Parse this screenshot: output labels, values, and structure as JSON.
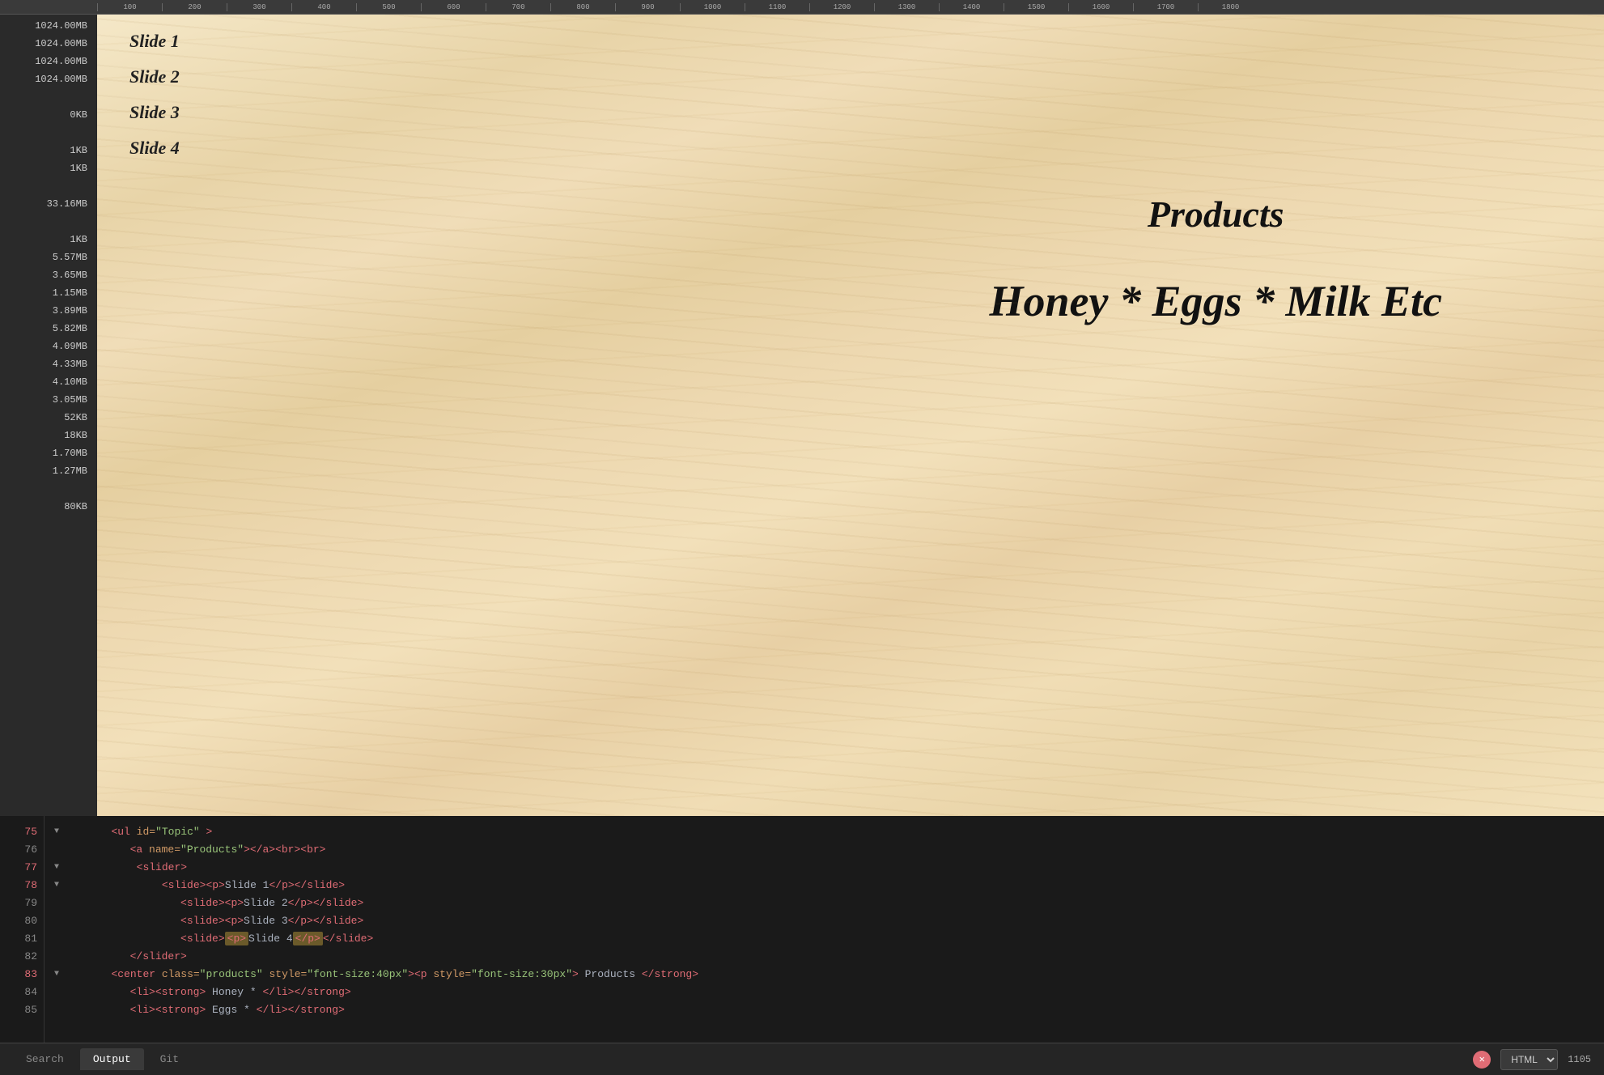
{
  "ruler": {
    "marks": [
      "100",
      "200",
      "300",
      "400",
      "500",
      "600",
      "700",
      "800",
      "900",
      "1000",
      "1100",
      "1200",
      "1300",
      "1400",
      "1500",
      "1600",
      "1700",
      "1800"
    ]
  },
  "sidebar": {
    "items": [
      "1024.00MB",
      "1024.00MB",
      "1024.00MB",
      "1024.00MB",
      "",
      "0KB",
      "",
      "1KB",
      "1KB",
      "",
      "33.16MB",
      "",
      "1KB",
      "5.57MB",
      "3.65MB",
      "1.15MB",
      "3.89MB",
      "5.82MB",
      "4.09MB",
      "4.33MB",
      "4.10MB",
      "3.05MB",
      "52KB",
      "18KB",
      "1.70MB",
      "1.27MB",
      "",
      "80KB"
    ]
  },
  "preview": {
    "slides": [
      "Slide 1",
      "Slide 2",
      "Slide 3",
      "Slide 4"
    ],
    "products_title": "Products",
    "products_subtitle": "Honey * Eggs * Milk Etc"
  },
  "editor": {
    "lines": [
      {
        "num": "75",
        "active": true,
        "indent": 2,
        "content": "<ul id=\"Topic\" >"
      },
      {
        "num": "76",
        "active": false,
        "indent": 3,
        "content": "<a name=\"Products\"></a><br><br>"
      },
      {
        "num": "77",
        "active": true,
        "indent": 3,
        "content": "<slider>"
      },
      {
        "num": "78",
        "active": true,
        "indent": 4,
        "content": "<slide><p>Slide 1</p></slide>"
      },
      {
        "num": "79",
        "active": false,
        "indent": 5,
        "content": "<slide><p>Slide 2</p></slide>"
      },
      {
        "num": "80",
        "active": false,
        "indent": 5,
        "content": "<slide><p>Slide 3</p></slide>"
      },
      {
        "num": "81",
        "active": false,
        "indent": 5,
        "content": "<slide><p>Slide 4</p></slide>"
      },
      {
        "num": "82",
        "active": false,
        "indent": 4,
        "content": "</slider>"
      },
      {
        "num": "83",
        "active": true,
        "indent": 2,
        "content": "<center class=\"products\" style=\"font-size:40px\"><p style=\"font-size:30px\"> Products </strong>"
      },
      {
        "num": "84",
        "active": false,
        "indent": 3,
        "content": "<li><strong> Honey * </li></strong>"
      },
      {
        "num": "85",
        "active": false,
        "indent": 3,
        "content": "<li><strong> Eggs * </li></strong>"
      }
    ]
  },
  "status_bar": {
    "tabs": [
      "Search",
      "Output",
      "Git"
    ],
    "active_tab": "Output",
    "language": "HTML",
    "line_count": "1105"
  }
}
